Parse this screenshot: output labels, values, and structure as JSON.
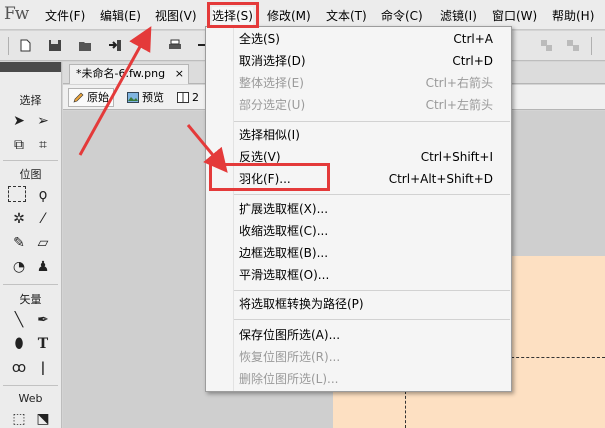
{
  "app": {
    "logo": "Fw"
  },
  "menubar": {
    "items": [
      {
        "label": "文件(F)"
      },
      {
        "label": "编辑(E)"
      },
      {
        "label": "视图(V)"
      },
      {
        "label": "选择(S)"
      },
      {
        "label": "修改(M)"
      },
      {
        "label": "文本(T)"
      },
      {
        "label": "命令(C)"
      },
      {
        "label": "滤镜(I)"
      },
      {
        "label": "窗口(W)"
      },
      {
        "label": "帮助(H)"
      }
    ]
  },
  "tools": {
    "sections": [
      {
        "label": "选择"
      },
      {
        "label": "位图"
      },
      {
        "label": "矢量"
      },
      {
        "label": "Web"
      }
    ]
  },
  "document": {
    "tab_label": "*未命名-6.fw.png",
    "tab_close": "×",
    "view_buttons": [
      {
        "label": "原始"
      },
      {
        "label": "预览"
      },
      {
        "label": "2"
      }
    ]
  },
  "select_menu": {
    "items": [
      {
        "label": "全选(S)",
        "shortcut": "Ctrl+A",
        "enabled": true
      },
      {
        "label": "取消选择(D)",
        "shortcut": "Ctrl+D",
        "enabled": true
      },
      {
        "label": "整体选择(E)",
        "shortcut": "Ctrl+右箭头",
        "enabled": false
      },
      {
        "label": "部分选定(U)",
        "shortcut": "Ctrl+左箭头",
        "enabled": false
      },
      {
        "label": "选择相似(I)",
        "shortcut": "",
        "enabled": true
      },
      {
        "label": "反选(V)",
        "shortcut": "Ctrl+Shift+I",
        "enabled": true
      },
      {
        "label": "羽化(F)...",
        "shortcut": "Ctrl+Alt+Shift+D",
        "enabled": true
      },
      {
        "label": "扩展选取框(X)...",
        "shortcut": "",
        "enabled": true
      },
      {
        "label": "收缩选取框(C)...",
        "shortcut": "",
        "enabled": true
      },
      {
        "label": "边框选取框(B)...",
        "shortcut": "",
        "enabled": true
      },
      {
        "label": "平滑选取框(O)...",
        "shortcut": "",
        "enabled": true
      },
      {
        "label": "将选取框转换为路径(P)",
        "shortcut": "",
        "enabled": true
      },
      {
        "label": "保存位图所选(A)...",
        "shortcut": "",
        "enabled": true
      },
      {
        "label": "恢复位图所选(R)...",
        "shortcut": "",
        "enabled": false
      },
      {
        "label": "删除位图所选(L)...",
        "shortcut": "",
        "enabled": false
      }
    ]
  },
  "colors": {
    "highlight": "#e43a3a",
    "canvas_fill": "#fde0c2",
    "disabled_text": "#9a9a9a"
  }
}
